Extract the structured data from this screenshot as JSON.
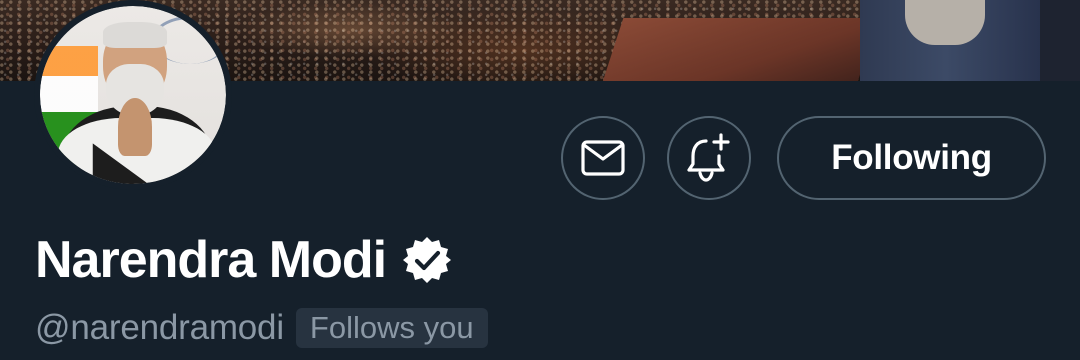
{
  "profile": {
    "display_name": "Narendra Modi",
    "handle": "@narendramodi",
    "follows_you_label": "Follows you",
    "verified_icon": "verified-badge-icon"
  },
  "actions": {
    "message_icon": "mail-icon",
    "notify_icon": "bell-plus-icon",
    "following_label": "Following"
  },
  "colors": {
    "background": "#15202b",
    "secondary_text": "#8b98a5",
    "button_border": "#536471",
    "badge_background": "#273340"
  }
}
